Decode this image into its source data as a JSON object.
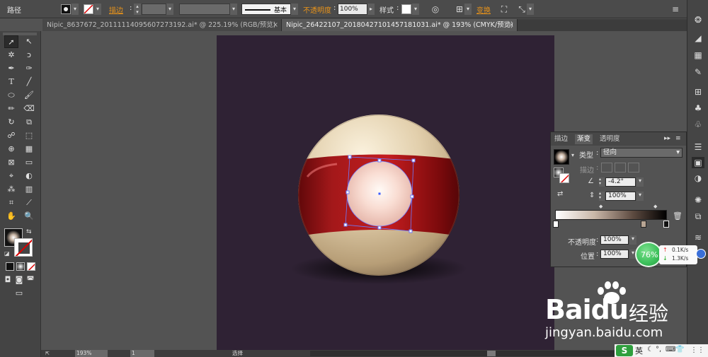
{
  "control_bar": {
    "object_type": "路径",
    "stroke_label": "描边",
    "stroke_sep": ":",
    "brush_style": "基本",
    "opacity_label": "不透明度",
    "opacity_sep": ":",
    "opacity_value": "100%",
    "style_label": "样式",
    "style_sep": ":",
    "transform_label": "变换"
  },
  "tabs": [
    {
      "title": "Nipic_8637672_20111114095607273192.ai* @ 225.19% (RGB/预览)",
      "active": false,
      "close": "×"
    },
    {
      "title": "Nipic_26422107_20180427101457181031.ai* @ 193% (CMYK/预览)",
      "active": true,
      "close": "×"
    }
  ],
  "gradient_panel": {
    "tabs": [
      "描边",
      "渐变",
      "透明度"
    ],
    "active_tab": "渐变",
    "type_label": "类型",
    "type_sep": ":",
    "type_value": "径向",
    "stroke_label": "描边",
    "stroke_sep": ":",
    "angle_value": "-4.2°",
    "aspect_value": "100%",
    "opacity_label": "不透明度",
    "opacity_sep": ":",
    "opacity_value": "100%",
    "location_label": "位置",
    "location_sep": ":",
    "location_value": "100%"
  },
  "status_bar": {
    "zoom": "193%",
    "page": "1",
    "tool_status": "选择"
  },
  "net_widget": {
    "percent": "76%",
    "upload": "0.1K/s",
    "download": "1.3K/s"
  },
  "watermark": {
    "brand_text": "Baidu",
    "brand_suffix": "经验",
    "url": "jingyan.baidu.com"
  },
  "taskbar": {
    "ime_label": "英"
  },
  "colors": {
    "artboard": "#2f2234",
    "ball_cream": "#e8d7b5",
    "ball_red": "#8d0e10",
    "accent_orange": "#e8931a",
    "net_green": "#3fc35d"
  }
}
